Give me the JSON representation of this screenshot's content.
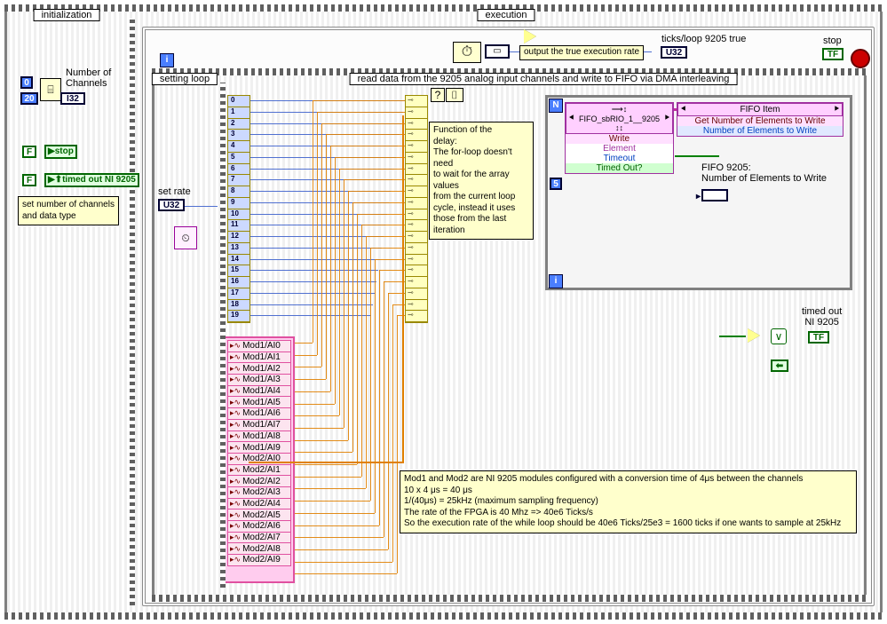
{
  "init": {
    "title": "initialization",
    "const_zero": "0",
    "const_twenty": "20",
    "channels_label": "Number of\nChannels",
    "i32": "I32",
    "false1": "F",
    "stop_local": "▶stop",
    "false2": "F",
    "timedout_local": "▶⬆timed out NI 9205",
    "comment": "set number of channels\nand data type"
  },
  "exec": {
    "title": "execution",
    "ticks_label": "ticks/loop 9205 true",
    "u32_ticks": "U32",
    "stop_label": "stop",
    "tf_stop": "TF",
    "output_rate": "output the true execution rate",
    "setting_title": "setting loop",
    "read_title": "read data from the 9205 analog input channels and write to FIFO via DMA interleaving",
    "setrate_label": "set rate",
    "u32_rate": "U32",
    "array_idx": [
      "0",
      "1",
      "2",
      "3",
      "4",
      "5",
      "6",
      "7",
      "8",
      "9",
      "10",
      "11",
      "12",
      "13",
      "14",
      "15",
      "16",
      "17",
      "18",
      "19"
    ],
    "io_channels": [
      "Mod1/AI0",
      "Mod1/AI1",
      "Mod1/AI2",
      "Mod1/AI3",
      "Mod1/AI4",
      "Mod1/AI5",
      "Mod1/AI6",
      "Mod1/AI7",
      "Mod1/AI8",
      "Mod1/AI9",
      "Mod2/AI0",
      "Mod2/AI1",
      "Mod2/AI2",
      "Mod2/AI3",
      "Mod2/AI4",
      "Mod2/AI5",
      "Mod2/AI6",
      "Mod2/AI7",
      "Mod2/AI8",
      "Mod2/AI9"
    ],
    "delay_comment": "Function of the\ndelay:\nThe for-loop doesn't\nneed\nto wait for the array\nvalues\nfrom the current loop\ncycle, instead it uses\nthose from the last\niteration",
    "for_const5": "5",
    "fifo_node": {
      "title": "⟶↕ FIFO_sbRIO_1__9205  ↕↕",
      "rows": [
        "Write",
        "Element",
        "Timeout",
        "Timed Out?"
      ]
    },
    "fifo_item": {
      "title": "FIFO Item",
      "row1": "Get Number of Elements to Write",
      "row2": "Number of Elements to Write"
    },
    "fifo_elems_label": "FIFO 9205:\nNumber of Elements to Write",
    "bottom_comment": "Mod1 and Mod2 are NI 9205 modules configured with a conversion time of 4μs between the channels\n10 x 4 μs = 40 μs\n1/(40μs) = 25kHz (maximum sampling frequency)\nThe rate of the FPGA is 40 Mhz => 40e6 Ticks/s\nSo the execution rate of the while loop should be 40e6 Ticks/25e3 = 1600 ticks  if one wants to sample at 25kHz",
    "timedout_label": "timed out\nNI 9205",
    "tf_timedout": "TF"
  }
}
